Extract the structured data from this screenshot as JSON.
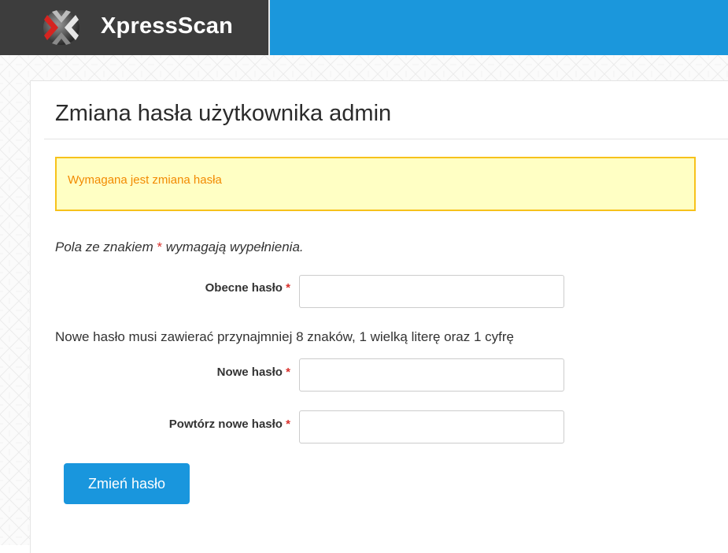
{
  "header": {
    "brand": "XpressScan",
    "logo_icon": "xpressscan-x-logo-icon",
    "brand_color": "#3d3d3d",
    "accent_color": "#1b97dc"
  },
  "page": {
    "title": "Zmiana hasła użytkownika admin"
  },
  "alert": {
    "text": "Wymagana jest zmiana hasła",
    "text_color": "#f28a00",
    "border_color": "#f7c21b",
    "background": "#ffffc4"
  },
  "form": {
    "required_note_before": "Pola ze znakiem ",
    "required_star": "*",
    "required_note_after": " wymagają wypełnienia.",
    "current_password_label": "Obecne hasło",
    "current_password_value": "",
    "password_hint": "Nowe hasło musi zawierać przynajmniej 8 znaków, 1 wielką literę oraz 1 cyfrę",
    "new_password_label": "Nowe hasło",
    "new_password_value": "",
    "repeat_password_label": "Powtórz nowe hasło",
    "repeat_password_value": "",
    "submit_label": "Zmień hasło"
  }
}
